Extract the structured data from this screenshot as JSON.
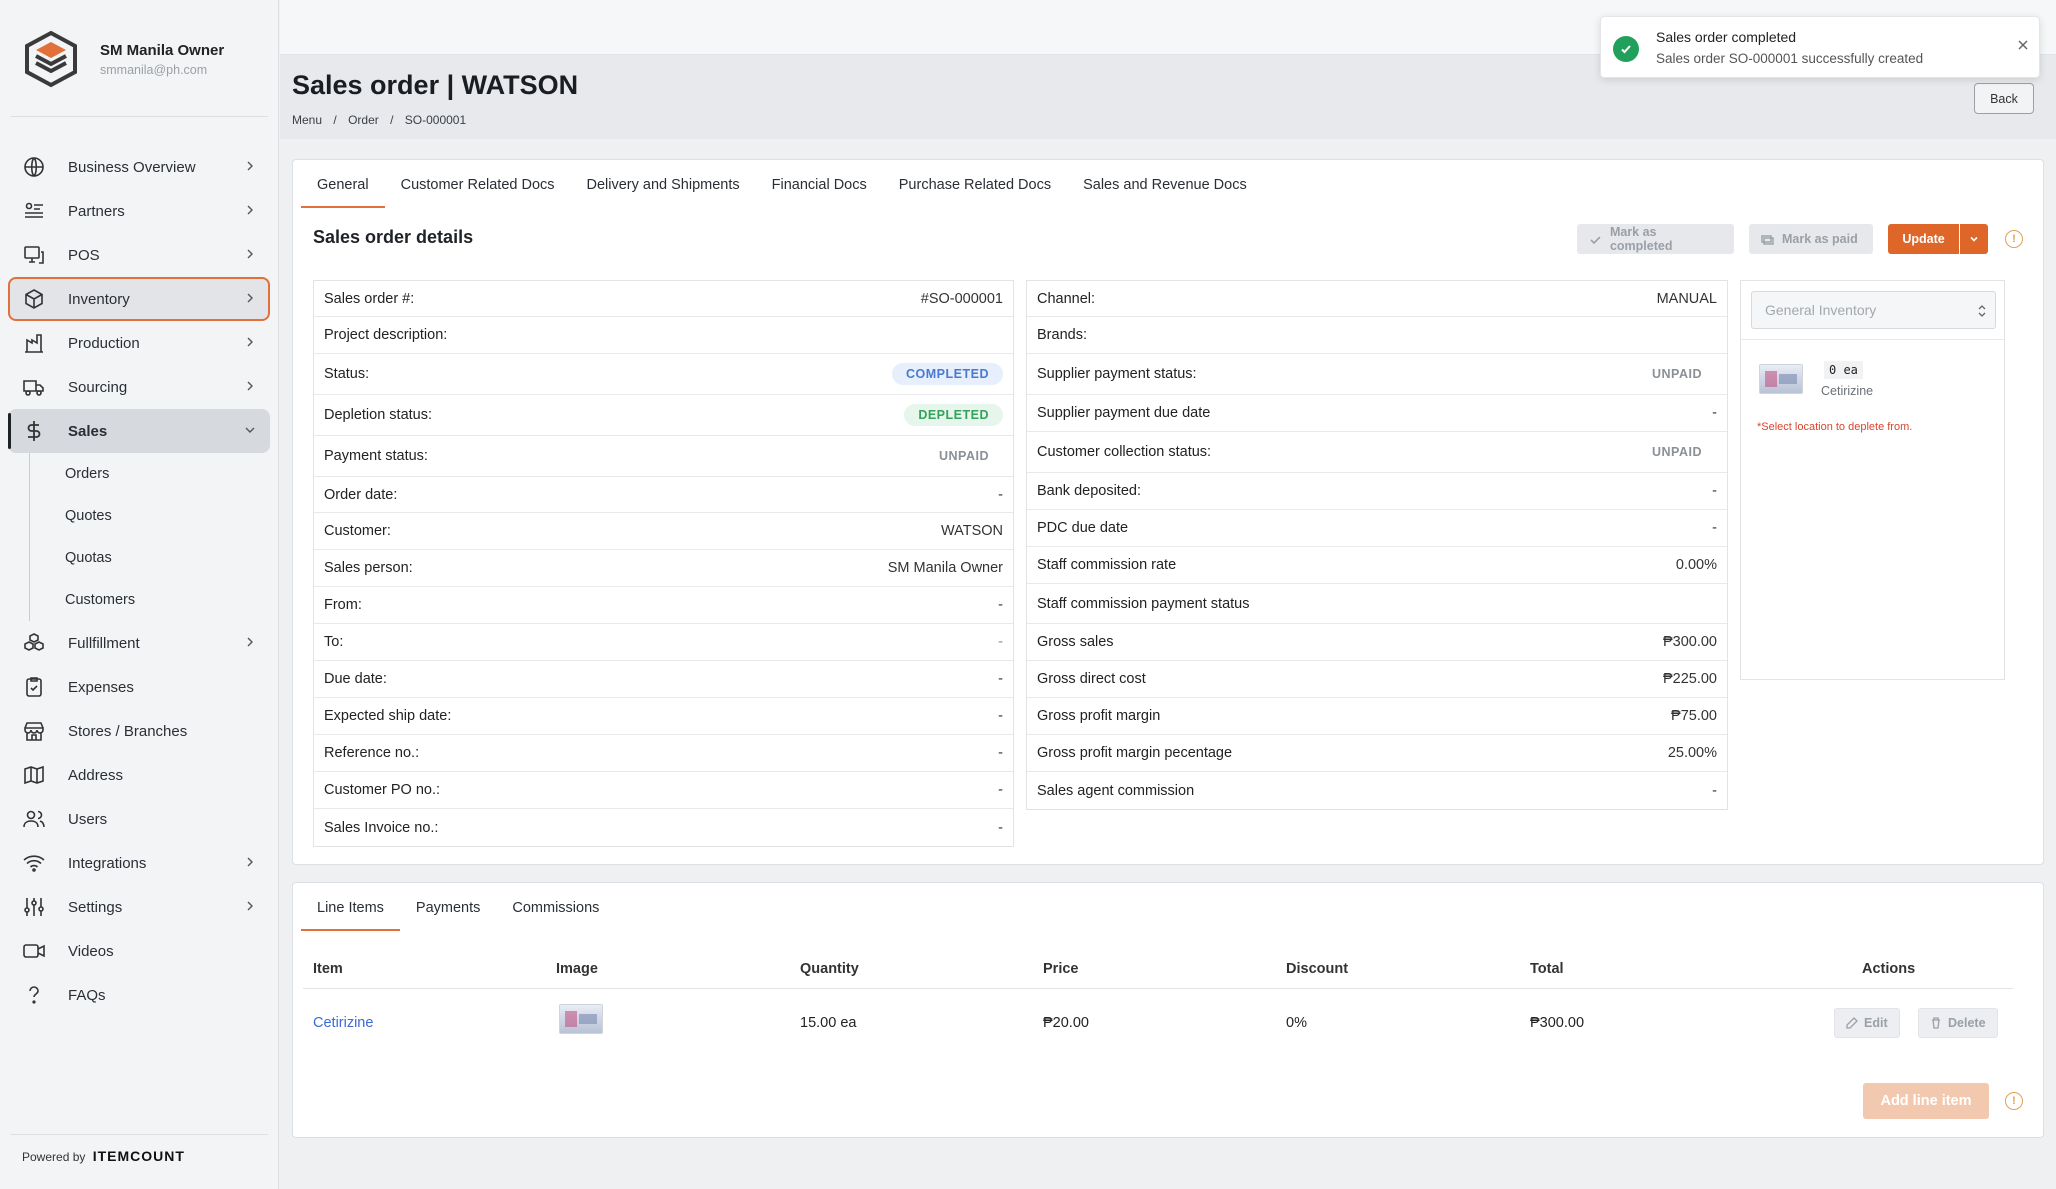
{
  "user": {
    "name": "SM Manila Owner",
    "email": "smmanila@ph.com"
  },
  "sidebar": {
    "items": [
      {
        "label": "Business Overview",
        "icon": "globe-icon"
      },
      {
        "label": "Partners",
        "icon": "partners-icon"
      },
      {
        "label": "POS",
        "icon": "pos-icon"
      },
      {
        "label": "Inventory",
        "icon": "box-icon"
      },
      {
        "label": "Production",
        "icon": "factory-icon"
      },
      {
        "label": "Sourcing",
        "icon": "truck-icon"
      },
      {
        "label": "Sales",
        "icon": "dollar-icon"
      },
      {
        "label": "Fullfillment",
        "icon": "boxes-icon"
      },
      {
        "label": "Expenses",
        "icon": "clipboard-icon"
      },
      {
        "label": "Stores / Branches",
        "icon": "store-icon"
      },
      {
        "label": "Address",
        "icon": "map-icon"
      },
      {
        "label": "Users",
        "icon": "users-icon"
      },
      {
        "label": "Integrations",
        "icon": "wifi-icon"
      },
      {
        "label": "Settings",
        "icon": "sliders-icon"
      },
      {
        "label": "Videos",
        "icon": "video-icon"
      },
      {
        "label": "FAQs",
        "icon": "question-icon"
      }
    ],
    "sales_sub": [
      "Orders",
      "Quotes",
      "Quotas",
      "Customers"
    ],
    "powered_by": "Powered by",
    "powered_brand": "ITEMCOUNT"
  },
  "toast": {
    "title": "Sales order completed",
    "message": "Sales order SO-000001 successfully created"
  },
  "page": {
    "title": "Sales order | WATSON",
    "back": "Back"
  },
  "breadcrumb": [
    "Menu",
    "/",
    "Order",
    "/",
    "SO-000001"
  ],
  "tabs": [
    "General",
    "Customer Related Docs",
    "Delivery and Shipments",
    "Financial Docs",
    "Purchase Related Docs",
    "Sales and Revenue Docs"
  ],
  "details": {
    "title": "Sales order details",
    "mark_completed": "Mark as completed",
    "mark_paid": "Mark as paid",
    "update": "Update",
    "left": [
      {
        "label": "Sales order #:",
        "value": "#SO-000001"
      },
      {
        "label": "Project description:",
        "value": ""
      },
      {
        "label": "Status:",
        "value": "COMPLETED"
      },
      {
        "label": "Depletion status:",
        "value": "DEPLETED"
      },
      {
        "label": "Payment status:",
        "value": "UNPAID"
      },
      {
        "label": "Order date:",
        "value": "-"
      },
      {
        "label": "Customer:",
        "value": "WATSON"
      },
      {
        "label": "Sales person:",
        "value": "SM Manila Owner"
      },
      {
        "label": "From:",
        "value": "-"
      },
      {
        "label": "To:",
        "value": "-"
      },
      {
        "label": "Due date:",
        "value": "-"
      },
      {
        "label": "Expected ship date:",
        "value": "-"
      },
      {
        "label": "Reference no.:",
        "value": "-"
      },
      {
        "label": "Customer PO no.:",
        "value": "-"
      },
      {
        "label": "Sales Invoice no.:",
        "value": "-"
      }
    ],
    "right": [
      {
        "label": "Channel:",
        "value": "MANUAL"
      },
      {
        "label": "Brands:",
        "value": ""
      },
      {
        "label": "Supplier payment status:",
        "value": "UNPAID"
      },
      {
        "label": "Supplier payment due date",
        "value": "-"
      },
      {
        "label": "Customer collection status:",
        "value": "UNPAID"
      },
      {
        "label": "Bank deposited:",
        "value": "-"
      },
      {
        "label": "PDC due date",
        "value": "-"
      },
      {
        "label": "Staff commission rate",
        "value": "0.00%"
      },
      {
        "label": "Staff commission payment status",
        "value": ""
      },
      {
        "label": "Gross sales",
        "value": "₱300.00"
      },
      {
        "label": "Gross direct cost",
        "value": "₱225.00"
      },
      {
        "label": "Gross profit margin",
        "value": "₱75.00"
      },
      {
        "label": "Gross profit margin pecentage",
        "value": "25.00%"
      },
      {
        "label": "Sales agent commission",
        "value": "-"
      }
    ]
  },
  "inventory_panel": {
    "select_placeholder": "General Inventory",
    "qty": "0 ea",
    "product": "Cetirizine",
    "hint": "*Select location to deplete from."
  },
  "line_tabs": [
    "Line Items",
    "Payments",
    "Commissions"
  ],
  "line_items": {
    "headers": [
      "Item",
      "Image",
      "Quantity",
      "Price",
      "Discount",
      "Total",
      "Actions"
    ],
    "rows": [
      {
        "item": "Cetirizine",
        "quantity": "15.00 ea",
        "price": "₱20.00",
        "discount": "0%",
        "total": "₱300.00"
      }
    ],
    "edit": "Edit",
    "delete": "Delete",
    "add": "Add line item"
  },
  "colors": {
    "accent": "#dd6628",
    "success": "#21a05b",
    "link": "#3d6ad6"
  }
}
